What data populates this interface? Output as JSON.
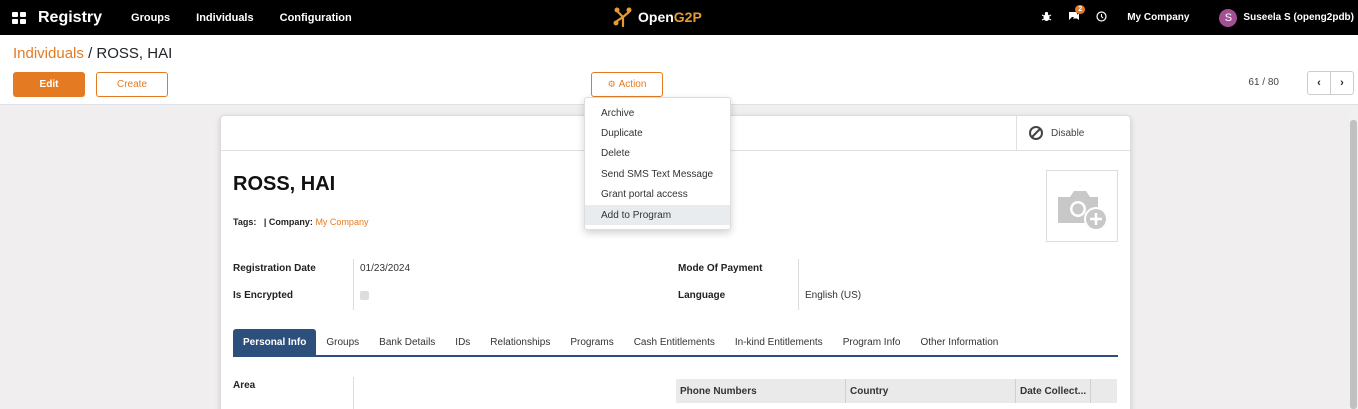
{
  "navbar": {
    "app_title": "Registry",
    "menu": [
      "Groups",
      "Individuals",
      "Configuration"
    ],
    "brand": {
      "prefix": "Open",
      "highlight": "G2P"
    },
    "chat_count": "2",
    "company": "My Company",
    "avatar_letter": "S",
    "user": "Suseela S (openg2pdb)"
  },
  "breadcrumb": {
    "parent": "Individuals",
    "separator": "/",
    "current": "ROSS, HAI"
  },
  "buttons": {
    "edit": "Edit",
    "create": "Create",
    "action": "Action",
    "disable": "Disable"
  },
  "pager": {
    "value": "61 / 80",
    "prev": "‹",
    "next": "›"
  },
  "action_menu": [
    "Archive",
    "Duplicate",
    "Delete",
    "Send SMS Text Message",
    "Grant portal access",
    "Add to Program"
  ],
  "record": {
    "name": "ROSS, HAI",
    "tags_label": "Tags:",
    "tags_sep": "|",
    "company_label": "Company:",
    "company_value": "My Company",
    "fields": {
      "registration_date_label": "Registration Date",
      "registration_date": "01/23/2024",
      "is_encrypted_label": "Is Encrypted",
      "mode_of_payment_label": "Mode Of Payment",
      "mode_of_payment": "",
      "language_label": "Language",
      "language": "English (US)"
    },
    "area_label": "Area"
  },
  "tabs": [
    "Personal Info",
    "Groups",
    "Bank Details",
    "IDs",
    "Relationships",
    "Programs",
    "Cash Entitlements",
    "In-kind Entitlements",
    "Program Info",
    "Other Information"
  ],
  "phone_table": {
    "columns": [
      "Phone Numbers",
      "Country",
      "Date Collect..."
    ]
  },
  "colors": {
    "accent": "#e47b22",
    "tab_active": "#2c4f7c",
    "navbar": "#000000"
  }
}
